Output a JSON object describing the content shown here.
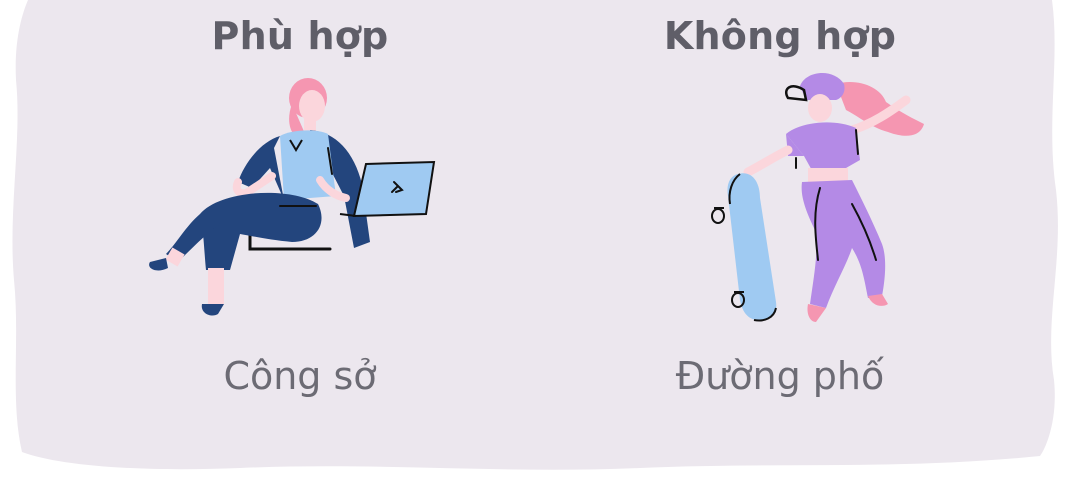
{
  "columns": [
    {
      "heading": "Phù hợp",
      "caption": "Công sở",
      "illustration_icon": "office-woman-laptop-icon"
    },
    {
      "heading": "Không hợp",
      "caption": "Đường phố",
      "illustration_icon": "street-skater-girl-icon"
    }
  ],
  "colors": {
    "background_blob": "#ece7ee",
    "heading": "#5f5e68",
    "caption": "#6c6b74",
    "pink": "#f596b1",
    "skin": "#fbd6dc",
    "navy": "#23457d",
    "light_blue": "#9fcaf2",
    "purple": "#b48ae6"
  }
}
